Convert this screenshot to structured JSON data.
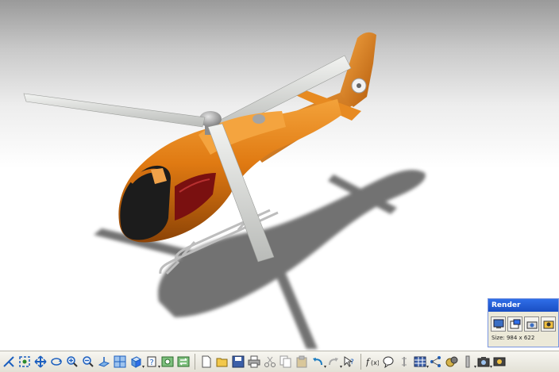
{
  "render_panel": {
    "title": "Render",
    "size_text": "Size: 984 x 622",
    "icons": [
      "render-image-icon",
      "render-window-icon",
      "render-sequence-icon",
      "render-settings-icon"
    ]
  },
  "toolbar": {
    "view_tools": [
      "axis-icon",
      "fit-all-icon",
      "pan-icon",
      "rotate-icon",
      "zoom-in-icon",
      "zoom-out-icon",
      "normal-view-icon",
      "multi-view-icon",
      "iso-view-icon",
      "view-mode-icon",
      "hide-show-icon",
      "swap-space-icon"
    ],
    "file_tools": [
      "new-icon",
      "open-icon",
      "save-icon",
      "print-icon",
      "cut-icon",
      "copy-icon",
      "paste-icon",
      "undo-icon",
      "redo-icon",
      "whats-this-icon"
    ],
    "misc_tools": [
      "formula-icon",
      "comment-icon",
      "measure-icon",
      "table-icon",
      "tree-icon",
      "material-icon",
      "catalog-icon",
      "camera-icon",
      "render-scene-icon"
    ]
  },
  "colors": {
    "fuselage": "#e07a12",
    "fuselage_dark": "#9a4a05",
    "canopy": "#1c1c1c",
    "window_red": "#7a1010",
    "rotor": "#d7d9d6",
    "shadow": "#555555",
    "accent_title": "#2f6ee8"
  }
}
